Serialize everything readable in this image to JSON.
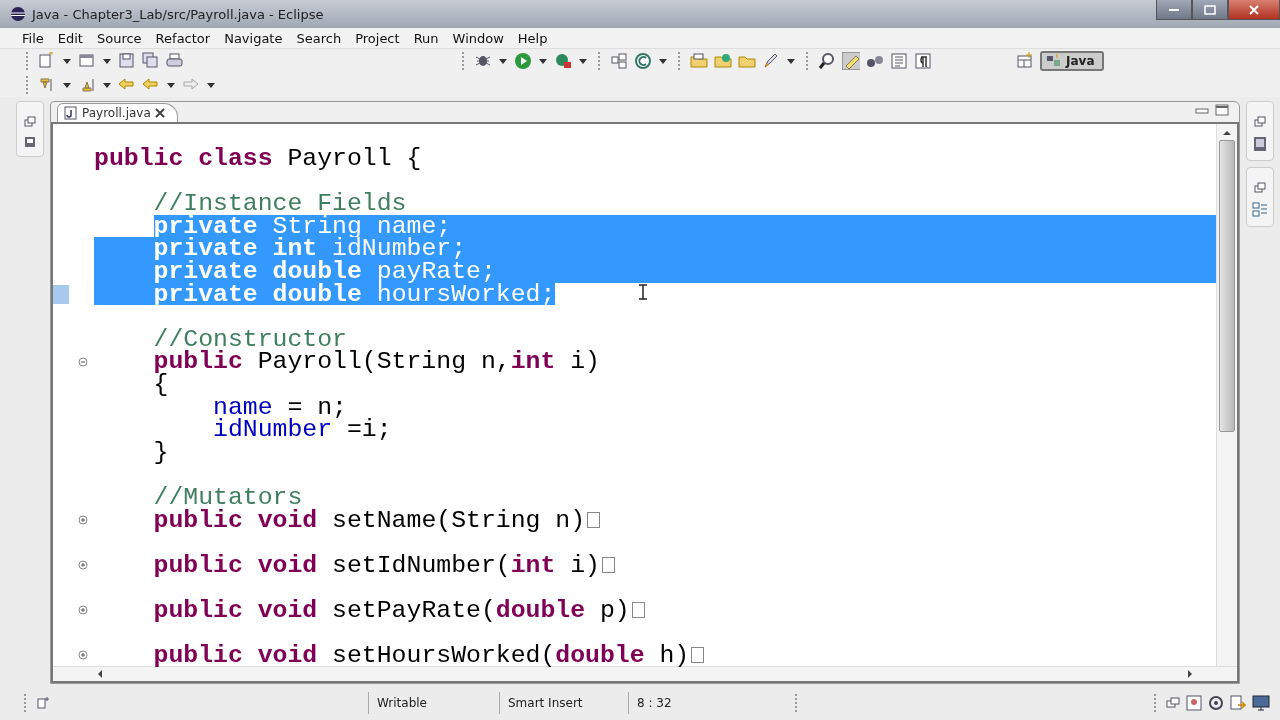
{
  "window": {
    "title": "Java - Chapter3_Lab/src/Payroll.java - Eclipse"
  },
  "menu": [
    "File",
    "Edit",
    "Source",
    "Refactor",
    "Navigate",
    "Search",
    "Project",
    "Run",
    "Window",
    "Help"
  ],
  "perspective": {
    "label": "Java",
    "selected": true
  },
  "tabs": [
    {
      "label": "Payroll.java",
      "selected": true
    }
  ],
  "code_lines": [
    {
      "tokens": [
        {
          "kind": "keyword",
          "text": "public "
        },
        {
          "kind": "keyword",
          "text": "class "
        },
        {
          "kind": "plain",
          "text": "Payroll {"
        }
      ],
      "selected": false
    },
    {
      "selected": false
    },
    {
      "tokens": [
        {
          "kind": "comment",
          "text": "    //Instance Fields"
        }
      ],
      "selected": false
    },
    {
      "tokens": [
        {
          "kind": "keyword",
          "text": "    private "
        },
        {
          "kind": "plain",
          "text": "String "
        },
        {
          "kind": "field",
          "text": "name"
        },
        {
          "kind": "plain",
          "text": ";"
        }
      ],
      "selected": true
    },
    {
      "tokens": [
        {
          "kind": "keyword",
          "text": "    private "
        },
        {
          "kind": "keyword",
          "text": "int "
        },
        {
          "kind": "field",
          "text": "idNumber"
        },
        {
          "kind": "plain",
          "text": ";"
        }
      ],
      "selected": true
    },
    {
      "tokens": [
        {
          "kind": "keyword",
          "text": "    private "
        },
        {
          "kind": "keyword",
          "text": "double "
        },
        {
          "kind": "field",
          "text": "payRate"
        },
        {
          "kind": "plain",
          "text": ";"
        }
      ],
      "selected": true
    },
    {
      "tokens": [
        {
          "kind": "keyword",
          "text": "    private "
        },
        {
          "kind": "keyword",
          "text": "double "
        },
        {
          "kind": "field",
          "text": "hoursWorked"
        },
        {
          "kind": "plain",
          "text": ";"
        }
      ],
      "selected": true
    },
    {
      "selected": false
    },
    {
      "tokens": [
        {
          "kind": "comment",
          "text": "    //Constructor"
        }
      ],
      "selected": false
    },
    {
      "tokens": [
        {
          "kind": "keyword",
          "text": "    public "
        },
        {
          "kind": "plain",
          "text": "Payroll(String n,"
        },
        {
          "kind": "keyword",
          "text": "int "
        },
        {
          "kind": "plain",
          "text": "i)"
        }
      ],
      "selected": false,
      "folded": false
    },
    {
      "tokens": [
        {
          "kind": "plain",
          "text": "    {"
        }
      ],
      "selected": false
    },
    {
      "tokens": [
        {
          "kind": "field",
          "text": "        name"
        },
        {
          "kind": "plain",
          "text": " = n;"
        }
      ],
      "selected": false
    },
    {
      "tokens": [
        {
          "kind": "field",
          "text": "        idNumber"
        },
        {
          "kind": "plain",
          "text": " =i;"
        }
      ],
      "selected": false
    },
    {
      "tokens": [
        {
          "kind": "plain",
          "text": "    }"
        }
      ],
      "selected": false
    },
    {
      "selected": false
    },
    {
      "tokens": [
        {
          "kind": "comment",
          "text": "    //Mutators"
        }
      ],
      "selected": false
    },
    {
      "tokens": [
        {
          "kind": "keyword",
          "text": "    public "
        },
        {
          "kind": "keyword",
          "text": "void "
        },
        {
          "kind": "plain",
          "text": "setName(String n)"
        }
      ],
      "selected": false,
      "folded": true
    },
    {
      "selected": false
    },
    {
      "tokens": [
        {
          "kind": "keyword",
          "text": "    public "
        },
        {
          "kind": "keyword",
          "text": "void "
        },
        {
          "kind": "plain",
          "text": "setIdNumber("
        },
        {
          "kind": "keyword",
          "text": "int "
        },
        {
          "kind": "plain",
          "text": "i)"
        }
      ],
      "selected": false,
      "folded": true
    },
    {
      "selected": false
    },
    {
      "tokens": [
        {
          "kind": "keyword",
          "text": "    public "
        },
        {
          "kind": "keyword",
          "text": "void "
        },
        {
          "kind": "plain",
          "text": "setPayRate("
        },
        {
          "kind": "keyword",
          "text": "double "
        },
        {
          "kind": "plain",
          "text": "p)"
        }
      ],
      "selected": false,
      "folded": true
    },
    {
      "selected": false
    },
    {
      "tokens": [
        {
          "kind": "keyword",
          "text": "    public "
        },
        {
          "kind": "keyword",
          "text": "void "
        },
        {
          "kind": "plain",
          "text": "setHoursWorked("
        },
        {
          "kind": "keyword",
          "text": "double "
        },
        {
          "kind": "plain",
          "text": "h)"
        }
      ],
      "selected": false,
      "folded": true
    }
  ],
  "status_bar": {
    "mode": "Writable",
    "insert_mode": "Smart Insert",
    "position": "8 : 32"
  }
}
